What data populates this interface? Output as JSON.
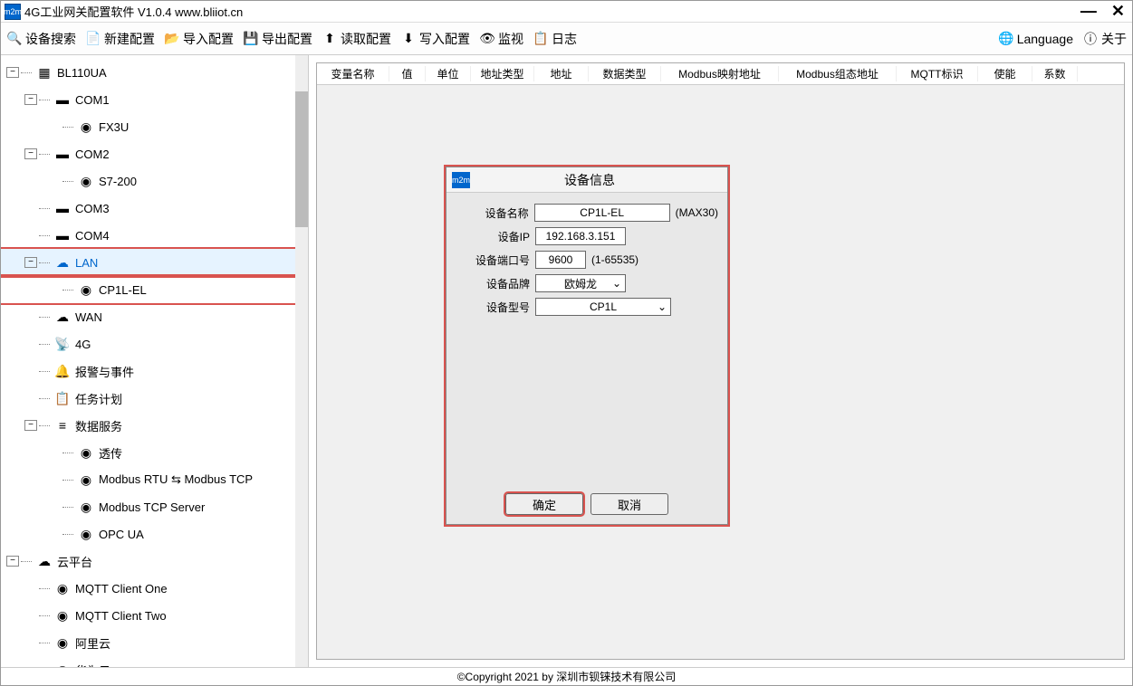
{
  "title": "4G工业网关配置软件 V1.0.4 www.bliiot.cn",
  "toolbar": {
    "search": "设备搜索",
    "newcfg": "新建配置",
    "import": "导入配置",
    "export": "导出配置",
    "read": "读取配置",
    "write": "写入配置",
    "monitor": "监视",
    "log": "日志",
    "language": "Language",
    "about": "关于"
  },
  "tree": {
    "root": "BL110UA",
    "com1": "COM1",
    "fx3u": "FX3U",
    "com2": "COM2",
    "s7200": "S7-200",
    "com3": "COM3",
    "com4": "COM4",
    "lan": "LAN",
    "cp1lel": "CP1L-EL",
    "wan": "WAN",
    "fourG": "4G",
    "alarm": "报警与事件",
    "task": "任务计划",
    "datasvc": "数据服务",
    "pass": "透传",
    "modbus_rtu": "Modbus RTU ⇆ Modbus TCP",
    "modbus_tcp": "Modbus TCP Server",
    "opcua": "OPC UA",
    "cloud": "云平台",
    "mqtt1": "MQTT Client One",
    "mqtt2": "MQTT Client Two",
    "ali": "阿里云",
    "huawei": "华为云"
  },
  "tableHeaders": {
    "varname": "变量名称",
    "value": "值",
    "unit": "单位",
    "addrtype": "地址类型",
    "addr": "地址",
    "datatype": "数据类型",
    "modbusmap": "Modbus映射地址",
    "modbusgrp": "Modbus组态地址",
    "mqtt": "MQTT标识",
    "enable": "使能",
    "coef": "系数"
  },
  "dialog": {
    "title": "设备信息",
    "name_label": "设备名称",
    "name_value": "CP1L-EL",
    "name_hint": "(MAX30)",
    "ip_label": "设备IP",
    "ip_value": "192.168.3.151",
    "port_label": "设备端口号",
    "port_value": "9600",
    "port_hint": "(1-65535)",
    "brand_label": "设备品牌",
    "brand_value": "欧姆龙",
    "model_label": "设备型号",
    "model_value": "CP1L",
    "ok": "确定",
    "cancel": "取消"
  },
  "status": "©Copyright 2021 by 深圳市钡铼技术有限公司"
}
